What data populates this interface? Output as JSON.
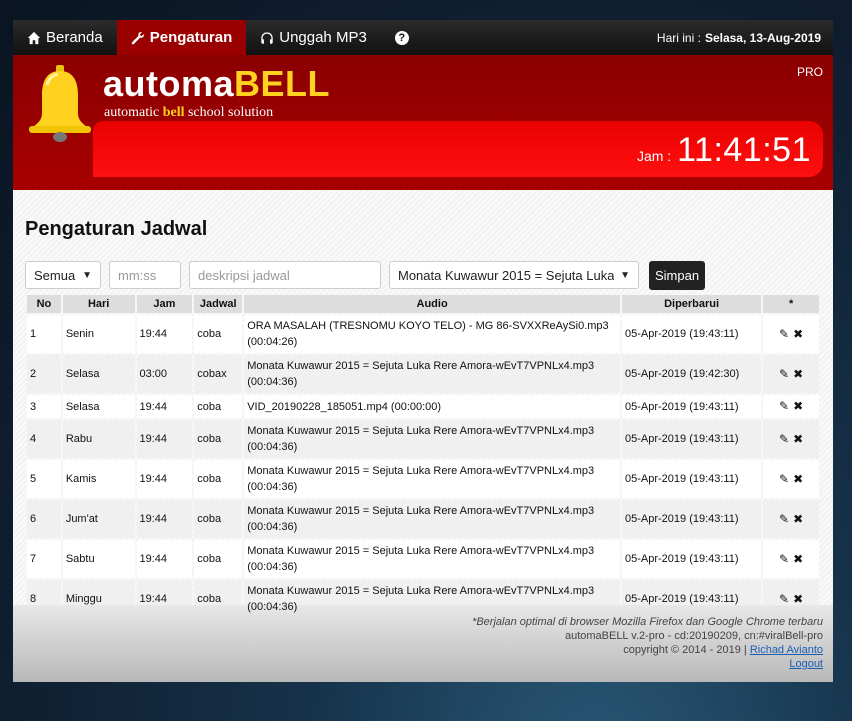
{
  "nav": {
    "items": [
      {
        "label": "Beranda",
        "icon": "home-icon"
      },
      {
        "label": "Pengaturan",
        "icon": "wrench-icon"
      },
      {
        "label": "Unggah MP3",
        "icon": "headphones-icon"
      }
    ],
    "help_icon": "?",
    "today_label": "Hari ini :",
    "today_value": "Selasa, 13-Aug-2019"
  },
  "header": {
    "brand_part1": "automa",
    "brand_part2": "BELL",
    "tagline_1": "automatic ",
    "tagline_bold": "bell",
    "tagline_2": " school solution",
    "edition": "PRO",
    "clock_label": "Jam :",
    "clock_time": "11:41:51",
    "colors": {
      "primary": "#a80000",
      "accent": "#ffd21f",
      "clock_bg": "#ff1010"
    }
  },
  "page_title": "Pengaturan Jadwal",
  "form": {
    "day_select": "Semua",
    "time_placeholder": "mm:ss",
    "desc_placeholder": "deskripsi jadwal",
    "audio_select": "Monata Kuwawur 2015 = Sejuta Luka",
    "save_label": "Simpan"
  },
  "table": {
    "headers": [
      "No",
      "Hari",
      "Jam",
      "Jadwal",
      "Audio",
      "Diperbarui",
      "*"
    ],
    "rows": [
      {
        "no": "1",
        "hari": "Senin",
        "jam": "19:44",
        "jadwal": "coba",
        "audio": "ORA MASALAH (TRESNOMU KOYO TELO) - MG 86-SVXXReAySi0.mp3 (00:04:26)",
        "updated": "05-Apr-2019 (19:43:11)"
      },
      {
        "no": "2",
        "hari": "Selasa",
        "jam": "03:00",
        "jadwal": "cobax",
        "audio": "Monata Kuwawur 2015 = Sejuta Luka Rere Amora-wEvT7VPNLx4.mp3 (00:04:36)",
        "updated": "05-Apr-2019 (19:42:30)"
      },
      {
        "no": "3",
        "hari": "Selasa",
        "jam": "19:44",
        "jadwal": "coba",
        "audio": "VID_20190228_185051.mp4 (00:00:00)",
        "updated": "05-Apr-2019 (19:43:11)"
      },
      {
        "no": "4",
        "hari": "Rabu",
        "jam": "19:44",
        "jadwal": "coba",
        "audio": "Monata Kuwawur 2015 = Sejuta Luka Rere Amora-wEvT7VPNLx4.mp3 (00:04:36)",
        "updated": "05-Apr-2019 (19:43:11)"
      },
      {
        "no": "5",
        "hari": "Kamis",
        "jam": "19:44",
        "jadwal": "coba",
        "audio": "Monata Kuwawur 2015 = Sejuta Luka Rere Amora-wEvT7VPNLx4.mp3 (00:04:36)",
        "updated": "05-Apr-2019 (19:43:11)"
      },
      {
        "no": "6",
        "hari": "Jum'at",
        "jam": "19:44",
        "jadwal": "coba",
        "audio": "Monata Kuwawur 2015 = Sejuta Luka Rere Amora-wEvT7VPNLx4.mp3 (00:04:36)",
        "updated": "05-Apr-2019 (19:43:11)"
      },
      {
        "no": "7",
        "hari": "Sabtu",
        "jam": "19:44",
        "jadwal": "coba",
        "audio": "Monata Kuwawur 2015 = Sejuta Luka Rere Amora-wEvT7VPNLx4.mp3 (00:04:36)",
        "updated": "05-Apr-2019 (19:43:11)"
      },
      {
        "no": "8",
        "hari": "Minggu",
        "jam": "19:44",
        "jadwal": "coba",
        "audio": "Monata Kuwawur 2015 = Sejuta Luka Rere Amora-wEvT7VPNLx4.mp3 (00:04:36)",
        "updated": "05-Apr-2019 (19:43:11)"
      }
    ],
    "edit_icon": "edit-icon",
    "delete_icon": "delete-icon"
  },
  "footer": {
    "note": "*Berjalan optimal di browser Mozilla Firefox dan Google Chrome terbaru",
    "version": "automaBELL v.2-pro - cd:20190209, cn:#viralBell-pro",
    "copyright": "copyright © 2014 - 2019 |",
    "author": "Richad Avianto",
    "logout": "Logout"
  }
}
